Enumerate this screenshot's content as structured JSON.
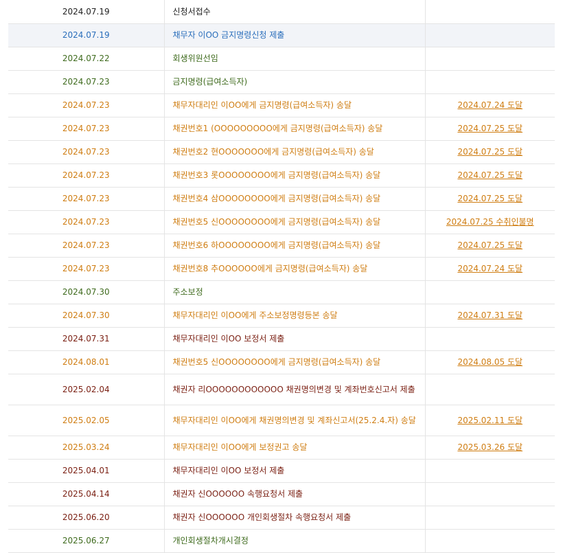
{
  "rows": [
    {
      "date": "2024.07.19",
      "content": "신청서접수",
      "result": "",
      "color": "black",
      "highlight": false,
      "tall": false
    },
    {
      "date": "2024.07.19",
      "content": "채무자 이OO 금지명령신청 제출",
      "result": "",
      "color": "blue",
      "highlight": true,
      "tall": false
    },
    {
      "date": "2024.07.22",
      "content": "회생위원선임",
      "result": "",
      "color": "green",
      "highlight": false,
      "tall": false
    },
    {
      "date": "2024.07.23",
      "content": "금지명령(급여소득자)",
      "result": "",
      "color": "green",
      "highlight": false,
      "tall": false
    },
    {
      "date": "2024.07.23",
      "content": "채무자대리인 이OO에게 금지명령(급여소득자) 송달",
      "result": "2024.07.24 도달",
      "color": "orange",
      "highlight": false,
      "tall": false
    },
    {
      "date": "2024.07.23",
      "content": "채권번호1 (OOOOOOOOO에게 금지명령(급여소득자) 송달",
      "result": "2024.07.25 도달",
      "color": "orange",
      "highlight": false,
      "tall": false
    },
    {
      "date": "2024.07.23",
      "content": "채권번호2 현OOOOOOO에게 금지명령(급여소득자) 송달",
      "result": "2024.07.25 도달",
      "color": "orange",
      "highlight": false,
      "tall": false
    },
    {
      "date": "2024.07.23",
      "content": "채권번호3 롯OOOOOOOO에게 금지명령(급여소득자) 송달",
      "result": "2024.07.25 도달",
      "color": "orange",
      "highlight": false,
      "tall": false
    },
    {
      "date": "2024.07.23",
      "content": "채권번호4 삼OOOOOOOO에게 금지명령(급여소득자) 송달",
      "result": "2024.07.25 도달",
      "color": "orange",
      "highlight": false,
      "tall": false
    },
    {
      "date": "2024.07.23",
      "content": "채권번호5 신OOOOOOOO에게 금지명령(급여소득자) 송달",
      "result": "2024.07.25 수취인불명",
      "color": "orange",
      "highlight": false,
      "tall": false
    },
    {
      "date": "2024.07.23",
      "content": "채권번호6 하OOOOOOOO에게 금지명령(급여소득자) 송달",
      "result": "2024.07.25 도달",
      "color": "orange",
      "highlight": false,
      "tall": false
    },
    {
      "date": "2024.07.23",
      "content": "채권번호8 추OOOOOO에게 금지명령(급여소득자) 송달",
      "result": "2024.07.24 도달",
      "color": "orange",
      "highlight": false,
      "tall": false
    },
    {
      "date": "2024.07.30",
      "content": "주소보정",
      "result": "",
      "color": "green",
      "highlight": false,
      "tall": false
    },
    {
      "date": "2024.07.30",
      "content": "채무자대리인 이OO에게 주소보정명령등본 송달",
      "result": "2024.07.31 도달",
      "color": "orange",
      "highlight": false,
      "tall": false
    },
    {
      "date": "2024.07.31",
      "content": "채무자대리인 이OO 보정서 제출",
      "result": "",
      "color": "maroon",
      "highlight": false,
      "tall": false
    },
    {
      "date": "2024.08.01",
      "content": "채권번호5 신OOOOOOOO에게 금지명령(급여소득자) 송달",
      "result": "2024.08.05 도달",
      "color": "orange",
      "highlight": false,
      "tall": false
    },
    {
      "date": "2025.02.04",
      "content": "채권자 리OOOOOOOOOOOO 채권명의변경 및 계좌번호신고서 제출",
      "result": "",
      "color": "maroon",
      "highlight": false,
      "tall": true
    },
    {
      "date": "2025.02.05",
      "content": "채무자대리인 이OO에게 채권명의변경 및 계좌신고서(25.2.4.자) 송달",
      "result": "2025.02.11 도달",
      "color": "orange",
      "highlight": false,
      "tall": true
    },
    {
      "date": "2025.03.24",
      "content": "채무자대리인 이OO에게 보정권고 송달",
      "result": "2025.03.26 도달",
      "color": "orange",
      "highlight": false,
      "tall": false
    },
    {
      "date": "2025.04.01",
      "content": "채무자대리인 이OO 보정서 제출",
      "result": "",
      "color": "maroon",
      "highlight": false,
      "tall": false
    },
    {
      "date": "2025.04.14",
      "content": "채권자 신OOOOOO 속행요청서 제출",
      "result": "",
      "color": "maroon",
      "highlight": false,
      "tall": false
    },
    {
      "date": "2025.06.20",
      "content": "채권자 신OOOOOO 개인회생절차 속행요청서 제출",
      "result": "",
      "color": "maroon",
      "highlight": false,
      "tall": false
    },
    {
      "date": "2025.06.27",
      "content": "개인회생절차개시결정",
      "result": "",
      "color": "green",
      "highlight": false,
      "tall": false
    }
  ]
}
